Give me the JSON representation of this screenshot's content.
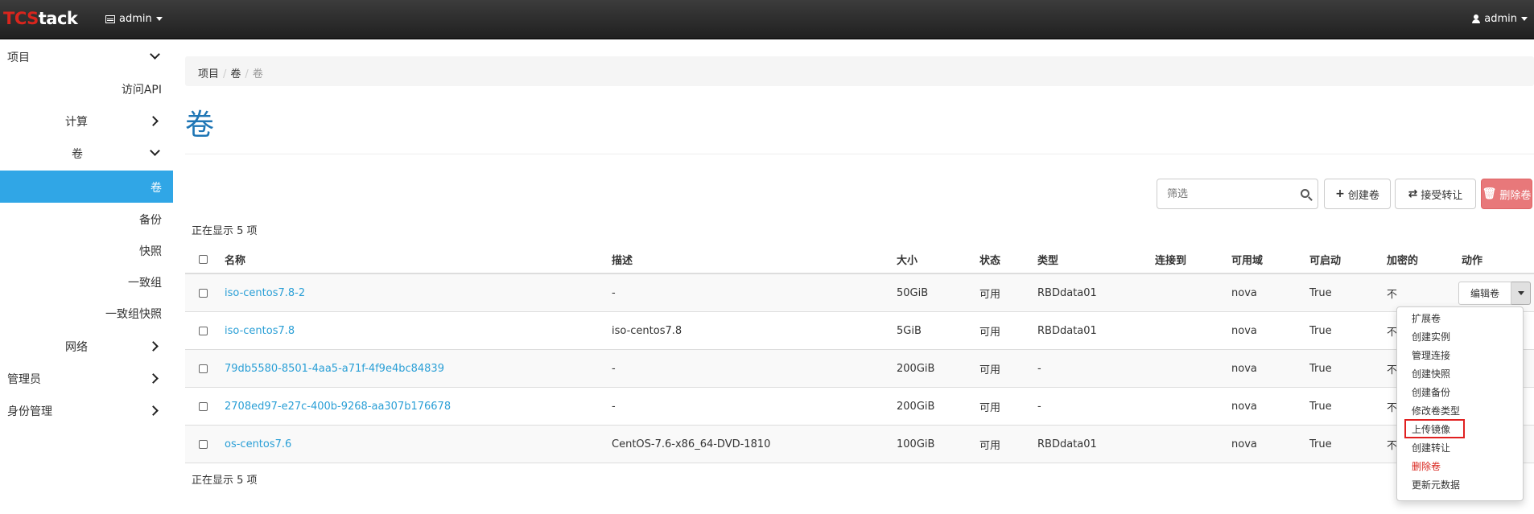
{
  "navbar": {
    "brand_part1": "TCS",
    "brand_part2": "tack",
    "project_label": "admin",
    "user_label": "admin"
  },
  "sidebar": {
    "items": [
      {
        "label": "项目"
      },
      {
        "label": "访问API"
      },
      {
        "label": "计算"
      },
      {
        "label": "卷"
      },
      {
        "label": "卷"
      },
      {
        "label": "备份"
      },
      {
        "label": "快照"
      },
      {
        "label": "一致组"
      },
      {
        "label": "一致组快照"
      },
      {
        "label": "网络"
      },
      {
        "label": "管理员"
      },
      {
        "label": "身份管理"
      }
    ]
  },
  "breadcrumb": [
    "项目",
    "卷",
    "卷"
  ],
  "breadcrumb_separator": "/",
  "page_title": "卷",
  "toolbar": {
    "filter_placeholder": "筛选",
    "create_label": "创建卷",
    "accept_transfer_label": "接受转让",
    "delete_label": "删除卷"
  },
  "showing_text": "正在显示 5 项",
  "table": {
    "columns": [
      "名称",
      "描述",
      "大小",
      "状态",
      "类型",
      "连接到",
      "可用域",
      "可启动",
      "加密的",
      "动作"
    ],
    "rows": [
      {
        "name": "iso-centos7.8-2",
        "desc": "-",
        "size": "50GiB",
        "status": "可用",
        "type": "RBDdata01",
        "attached": "",
        "zone": "nova",
        "bootable": "True",
        "encrypted": "不"
      },
      {
        "name": "iso-centos7.8",
        "desc": "iso-centos7.8",
        "size": "5GiB",
        "status": "可用",
        "type": "RBDdata01",
        "attached": "",
        "zone": "nova",
        "bootable": "True",
        "encrypted": "不"
      },
      {
        "name": "79db5580-8501-4aa5-a71f-4f9e4bc84839",
        "desc": "-",
        "size": "200GiB",
        "status": "可用",
        "type": "-",
        "attached": "",
        "zone": "nova",
        "bootable": "True",
        "encrypted": "不"
      },
      {
        "name": "2708ed97-e27c-400b-9268-aa307b176678",
        "desc": "-",
        "size": "200GiB",
        "status": "可用",
        "type": "-",
        "attached": "",
        "zone": "nova",
        "bootable": "True",
        "encrypted": "不"
      },
      {
        "name": "os-centos7.6",
        "desc": "CentOS-7.6-x86_64-DVD-1810",
        "size": "100GiB",
        "status": "可用",
        "type": "RBDdata01",
        "attached": "",
        "zone": "nova",
        "bootable": "True",
        "encrypted": "不"
      }
    ]
  },
  "row_action": {
    "edit_label": "编辑卷"
  },
  "action_menu": [
    "扩展卷",
    "创建实例",
    "管理连接",
    "创建快照",
    "创建备份",
    "修改卷类型",
    "上传镜像",
    "创建转让",
    "删除卷",
    "更新元数据"
  ],
  "colors": {
    "brand_red": "#d9251d",
    "active_sidebar": "#30a6e6",
    "link": "#2a9fd6",
    "title": "#1f76b5",
    "danger_button": "#e8787a",
    "highlight_box": "#e02020"
  }
}
